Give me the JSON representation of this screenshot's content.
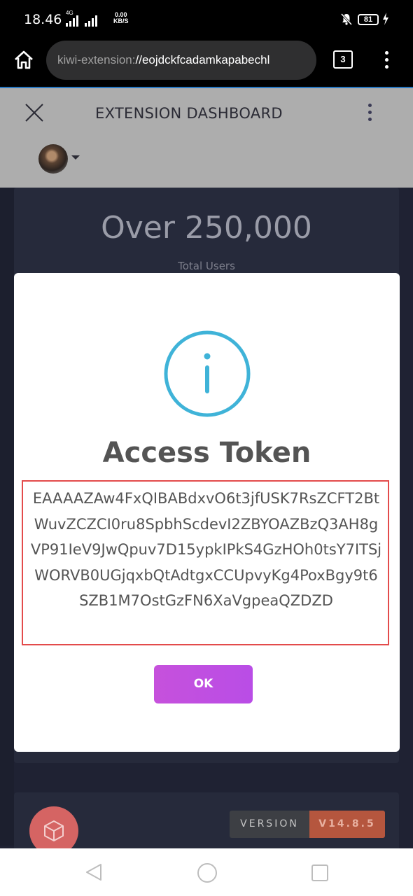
{
  "status_bar": {
    "time": "18.46",
    "network_type": "4G",
    "data_speed_value": "0.00",
    "data_speed_unit": "KB/S",
    "battery_level": "81"
  },
  "browser": {
    "url_scheme": "kiwi-extension:",
    "url_path": "//eojdckfcadamkapabechl",
    "tab_count": "3"
  },
  "extension_header": {
    "title": "EXTENSION DASHBOARD"
  },
  "stats": {
    "users_value": "Over 250,000",
    "users_label": "Total Users"
  },
  "modal": {
    "title": "Access Token",
    "token": "EAAAAZAw4FxQIBABdxvO6t3jfUSK7RsZCFT2BtWuvZCZCI0ru8SpbhScdevI2ZBYOAZBzQ3AH8gVP91IeV9JwQpuv7D15ypkIPkS4GzHOh0tsY7ITSjWORVB0UGjqxbQtAdtgxCCUpvyKg4PoxBgy9t6SZB1M7OstGzFN6XaVgpeaQZDZD",
    "ok_label": "OK"
  },
  "footer": {
    "version_label": "VERSION",
    "version_value": "V14.8.5"
  },
  "colors": {
    "modal_info_icon": "#3fb3d8",
    "ok_button": "#c34fe2",
    "token_border": "#e34b4b",
    "version_value_bg": "#b5563e"
  }
}
